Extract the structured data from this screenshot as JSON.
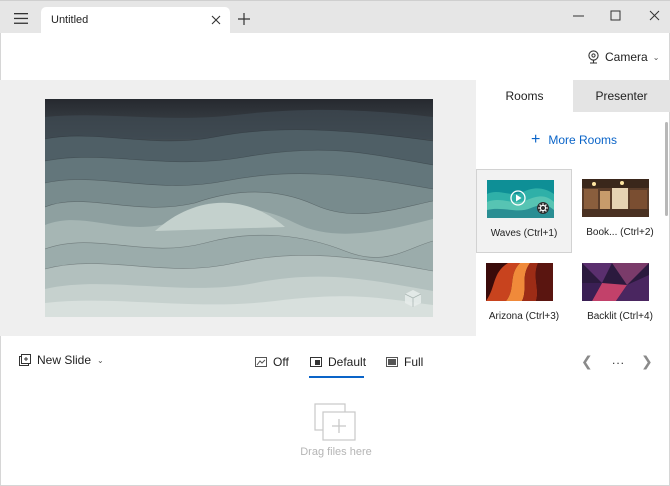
{
  "tab": {
    "title": "Untitled"
  },
  "toolbar": {
    "camera_label": "Camera"
  },
  "panel": {
    "tabs": [
      {
        "label": "Rooms",
        "selected": true
      },
      {
        "label": "Presenter",
        "selected": false
      }
    ],
    "more_rooms_label": "More Rooms",
    "rooms": [
      {
        "label": "Waves (Ctrl+1)",
        "selected": true
      },
      {
        "label": "Book... (Ctrl+2)",
        "selected": false
      },
      {
        "label": "Arizona (Ctrl+3)",
        "selected": false
      },
      {
        "label": "Backlit (Ctrl+4)",
        "selected": false
      }
    ]
  },
  "bottombar": {
    "new_slide_label": "New Slide",
    "modes": [
      {
        "label": "Off",
        "selected": false
      },
      {
        "label": "Default",
        "selected": true
      },
      {
        "label": "Full",
        "selected": false
      }
    ],
    "more_label": "..."
  },
  "dropzone": {
    "text": "Drag files here"
  },
  "colors": {
    "accent": "#0a64c8",
    "titlebar": "#e6e6e6",
    "canvas": "#efefef"
  },
  "icons": [
    "hamburger-icon",
    "close-icon",
    "plus-icon",
    "minimize-icon",
    "maximize-icon",
    "webcam-icon",
    "chevron-down-icon",
    "play-icon",
    "settings-icon",
    "new-slide-icon",
    "mode-off-icon",
    "mode-default-icon",
    "mode-full-icon",
    "chevron-left-icon",
    "chevron-right-icon",
    "drag-files-icon"
  ]
}
